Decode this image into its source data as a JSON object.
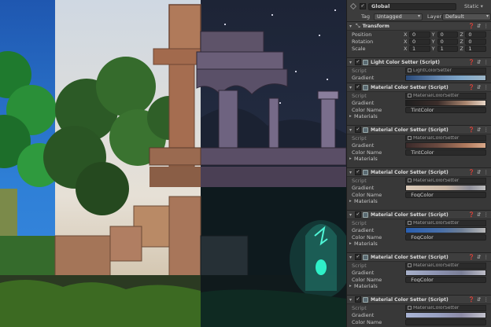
{
  "inspector": {
    "object_name": "Global",
    "static_label": "Static",
    "tag_label": "Tag",
    "tag_value": "Untagged",
    "layer_label": "Layer",
    "layer_value": "Default",
    "transform": {
      "title": "Transform",
      "rows": [
        {
          "label": "Position",
          "x": "0",
          "y": "0",
          "z": "0"
        },
        {
          "label": "Rotation",
          "x": "0",
          "y": "0",
          "z": "0"
        },
        {
          "label": "Scale",
          "x": "1",
          "y": "1",
          "z": "1"
        }
      ]
    },
    "light_setter": {
      "title": "Light Color Setter (Script)",
      "script_label": "Script",
      "script_value": "LightColorSetter",
      "gradient_label": "Gradient"
    },
    "material_setters": [
      {
        "title": "Material Color Setter (Script)",
        "script_label": "Script",
        "script_value": "MaterialColorSetter",
        "gradient_label": "Gradient",
        "color_name_label": "Color Name",
        "color_name": "_TintColor",
        "materials_label": "Materials",
        "grad": "linear-gradient(90deg,#1f1f1f,#3b2d2a 40%,#a9856f 75%,#e8d7c8)"
      },
      {
        "title": "Material Color Setter (Script)",
        "script_label": "Script",
        "script_value": "MaterialColorSetter",
        "gradient_label": "Gradient",
        "color_name_label": "Color Name",
        "color_name": "_TintColor",
        "materials_label": "Materials",
        "grad": "linear-gradient(90deg,#3a2a2a,#6b4a40 40%,#b07a5e 75%,#d9a98a)"
      },
      {
        "title": "Material Color Setter (Script)",
        "script_label": "Script",
        "script_value": "MaterialColorSetter",
        "gradient_label": "Gradient",
        "color_name_label": "Color Name",
        "color_name": "_FogColor",
        "materials_label": "Materials",
        "grad": "linear-gradient(90deg,#d9c9b8,#c8b5a4 50%,#8f8f9a 80%,#bcbcbc)"
      },
      {
        "title": "Material Color Setter (Script)",
        "script_label": "Script",
        "script_value": "MaterialColorSetter",
        "gradient_label": "Gradient",
        "color_name_label": "Color Name",
        "color_name": "_FogColor",
        "materials_label": "Materials",
        "grad": "linear-gradient(90deg,#2a5fb0,#4a70a8 45%,#6f7f95 70%,#b8b8b8)"
      },
      {
        "title": "Material Color Setter (Script)",
        "script_label": "Script",
        "script_value": "MaterialColorSetter",
        "gradient_label": "Gradient",
        "color_name_label": "Color Name",
        "color_name": "_FogColor",
        "materials_label": "Materials",
        "grad": "linear-gradient(90deg,#a7b0c9,#8c92b0 40%,#7a7e96 70%,#bdbdc7)"
      },
      {
        "title": "Material Color Setter (Script)",
        "script_label": "Script",
        "script_value": "MaterialColorSetter",
        "gradient_label": "Gradient",
        "color_name_label": "Color Name",
        "color_name": "",
        "materials_label": "",
        "grad": "linear-gradient(90deg,#a9b4d4,#98a0c2 40%,#8c8aa5 70%,#c3c3cd)"
      }
    ]
  },
  "colors": {
    "panel_bg": "#383838",
    "sky_day": "#2e7fd6",
    "sky_dusk": "#dcd6cc",
    "sky_night": "#1d2436",
    "crystal_glow": "#2ff0c8"
  }
}
